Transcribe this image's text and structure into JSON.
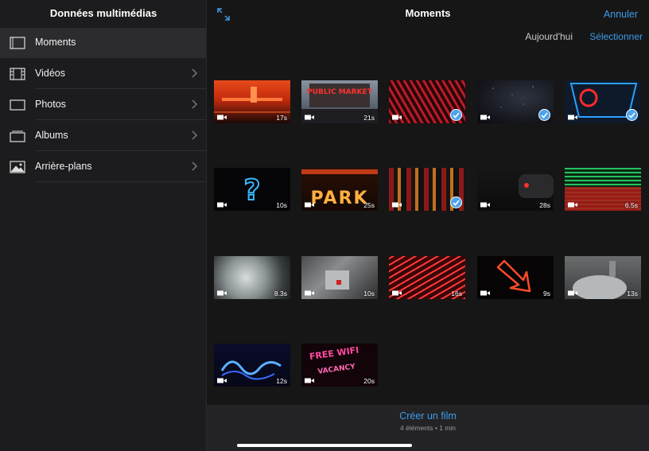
{
  "sidebar": {
    "title": "Données multimédias",
    "items": [
      {
        "label": "Moments",
        "icon": "moments-icon"
      },
      {
        "label": "Vidéos",
        "icon": "film-icon"
      },
      {
        "label": "Photos",
        "icon": "photo-frame-icon"
      },
      {
        "label": "Albums",
        "icon": "albums-icon"
      },
      {
        "label": "Arrière-plans",
        "icon": "landscape-icon"
      }
    ]
  },
  "header": {
    "title": "Moments",
    "cancel": "Annuler",
    "today": "Aujourd'hui",
    "select": "Sélectionner"
  },
  "clips": [
    {
      "duration": "17s",
      "selected": false
    },
    {
      "duration": "21s",
      "selected": false
    },
    {
      "duration": "",
      "selected": true
    },
    {
      "duration": "",
      "selected": true
    },
    {
      "duration": "",
      "selected": true
    },
    {
      "duration": "10s",
      "selected": false
    },
    {
      "duration": "25s",
      "selected": false
    },
    {
      "duration": "",
      "selected": true
    },
    {
      "duration": "28s",
      "selected": false
    },
    {
      "duration": "6.5s",
      "selected": false
    },
    {
      "duration": "8.3s",
      "selected": false
    },
    {
      "duration": "10s",
      "selected": false
    },
    {
      "duration": "16s",
      "selected": false
    },
    {
      "duration": "9s",
      "selected": false
    },
    {
      "duration": "13s",
      "selected": false
    },
    {
      "duration": "12s",
      "selected": false
    },
    {
      "duration": "20s",
      "selected": false
    }
  ],
  "thumb_texts": {
    "market": "PUBLIC MARKET",
    "park": "PARK",
    "qmark": "?",
    "free": "FREE WIFI",
    "vacancy": "VACANCY"
  },
  "footer": {
    "create": "Créer un film",
    "info": "4 éléments • 1 min"
  },
  "colors": {
    "accent": "#3d9be9",
    "check": "#4aa3ee"
  }
}
